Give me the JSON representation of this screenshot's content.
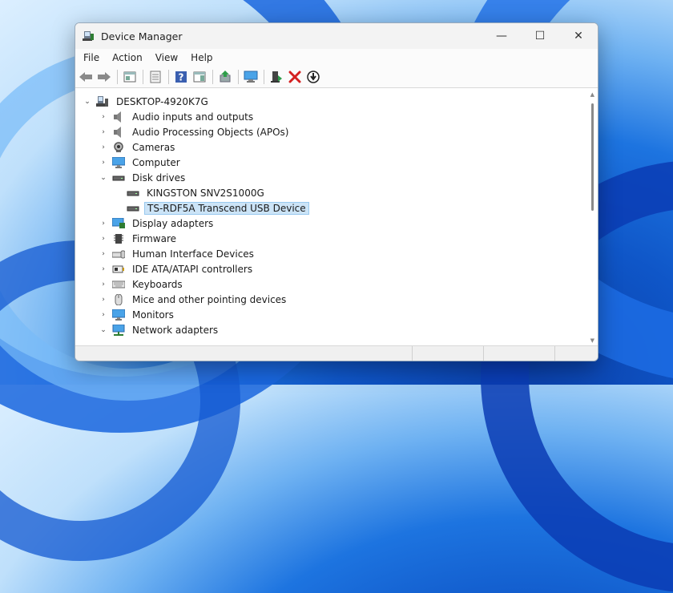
{
  "window": {
    "title": "Device Manager"
  },
  "window_controls": {
    "minimize": "—",
    "maximize": "☐",
    "close": "✕"
  },
  "menu": [
    "File",
    "Action",
    "View",
    "Help"
  ],
  "toolbar": [
    {
      "name": "back-arrow-icon"
    },
    {
      "name": "forward-arrow-icon"
    },
    {
      "name": "properties-pane-icon"
    },
    {
      "name": "view-list-icon"
    },
    {
      "name": "help-icon"
    },
    {
      "name": "action-pane-icon"
    },
    {
      "name": "update-driver-icon"
    },
    {
      "name": "scan-hardware-icon"
    },
    {
      "name": "enable-device-icon"
    },
    {
      "name": "uninstall-device-icon"
    },
    {
      "name": "download-driver-icon"
    }
  ],
  "tree": {
    "root": {
      "label": "DESKTOP-4920K7G",
      "icon": "computer-icon",
      "expanded": true
    },
    "items": [
      {
        "label": "Audio inputs and outputs",
        "icon": "speaker-icon",
        "expanded": false,
        "level": 1
      },
      {
        "label": "Audio Processing Objects (APOs)",
        "icon": "speaker-icon",
        "expanded": false,
        "level": 1
      },
      {
        "label": "Cameras",
        "icon": "camera-icon",
        "expanded": false,
        "level": 1
      },
      {
        "label": "Computer",
        "icon": "monitor-icon",
        "expanded": false,
        "level": 1
      },
      {
        "label": "Disk drives",
        "icon": "drive-icon",
        "expanded": true,
        "level": 1
      },
      {
        "label": "KINGSTON SNV2S1000G",
        "icon": "drive-icon",
        "level": 2
      },
      {
        "label": "TS-RDF5A Transcend USB Device",
        "icon": "drive-icon",
        "level": 2,
        "selected": true
      },
      {
        "label": "Display adapters",
        "icon": "display-adapter-icon",
        "expanded": false,
        "level": 1
      },
      {
        "label": "Firmware",
        "icon": "firmware-icon",
        "expanded": false,
        "level": 1
      },
      {
        "label": "Human Interface Devices",
        "icon": "hid-icon",
        "expanded": false,
        "level": 1
      },
      {
        "label": "IDE ATA/ATAPI controllers",
        "icon": "ide-controller-icon",
        "expanded": false,
        "level": 1
      },
      {
        "label": "Keyboards",
        "icon": "keyboard-icon",
        "expanded": false,
        "level": 1
      },
      {
        "label": "Mice and other pointing devices",
        "icon": "mouse-icon",
        "expanded": false,
        "level": 1
      },
      {
        "label": "Monitors",
        "icon": "monitor-icon",
        "expanded": false,
        "level": 1
      },
      {
        "label": "Network adapters",
        "icon": "network-adapter-icon",
        "expanded": true,
        "level": 1
      }
    ]
  },
  "colors": {
    "selection_bg": "#cce4f7",
    "selection_border": "#99c9ef",
    "accent": "#0f56c8"
  }
}
